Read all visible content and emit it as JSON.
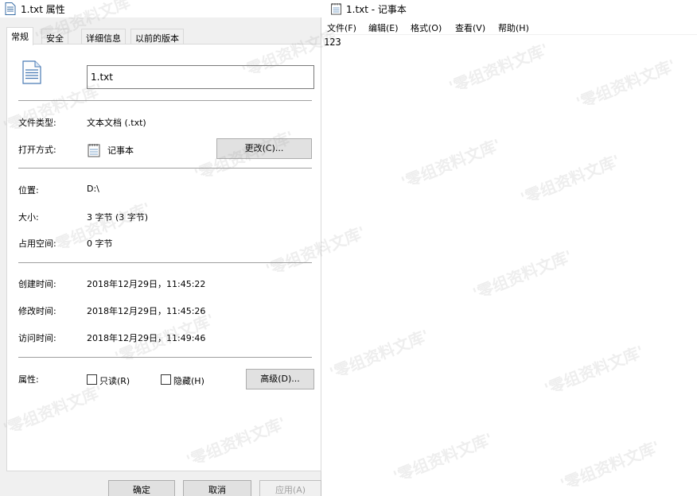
{
  "props": {
    "title": "1.txt 属性",
    "tabs": [
      {
        "label": "常规"
      },
      {
        "label": "安全"
      },
      {
        "label": "详细信息"
      },
      {
        "label": "以前的版本"
      }
    ],
    "filename": "1.txt",
    "file_type_label": "文件类型:",
    "file_type_value": "文本文档 (.txt)",
    "open_with_label": "打开方式:",
    "open_with_value": "记事本",
    "change_button": "更改(C)...",
    "location_label": "位置:",
    "location_value": "D:\\",
    "size_label": "大小:",
    "size_value": "3 字节 (3 字节)",
    "disk_size_label": "占用空间:",
    "disk_size_value": "0 字节",
    "created_label": "创建时间:",
    "created_value": "2018年12月29日，11:45:22",
    "modified_label": "修改时间:",
    "modified_value": "2018年12月29日，11:45:26",
    "accessed_label": "访问时间:",
    "accessed_value": "2018年12月29日，11:49:46",
    "attributes_label": "属性:",
    "readonly_label": "只读(R)",
    "hidden_label": "隐藏(H)",
    "advanced_button": "高级(D)...",
    "ok_button": "确定",
    "cancel_button": "取消",
    "apply_button": "应用(A)"
  },
  "notepad": {
    "title": "1.txt - 记事本",
    "menus": [
      {
        "label": "文件(F)"
      },
      {
        "label": "编辑(E)"
      },
      {
        "label": "格式(O)"
      },
      {
        "label": "查看(V)"
      },
      {
        "label": "帮助(H)"
      }
    ],
    "content": "123"
  },
  "watermark": "'零组资料文库'"
}
